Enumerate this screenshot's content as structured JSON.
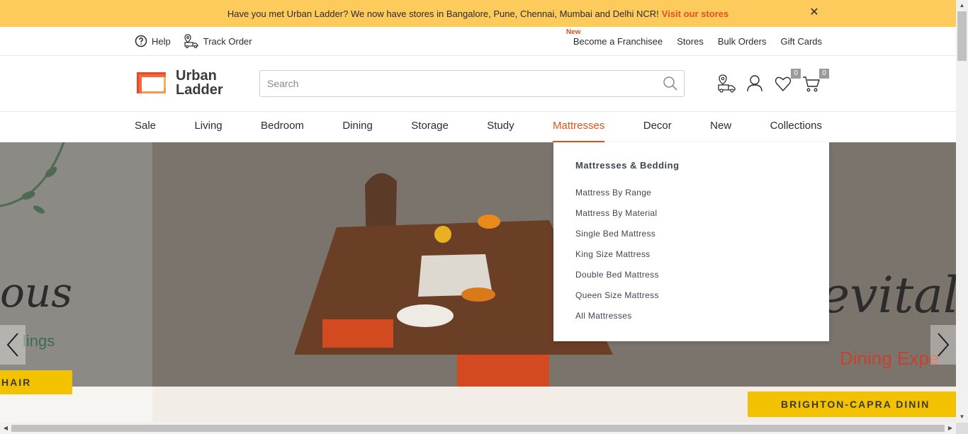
{
  "announcement": {
    "text": "Have you met Urban Ladder? We now have stores in Bangalore, Pune, Chennai, Mumbai and Delhi NCR!",
    "link": "Visit our stores",
    "close": "✕"
  },
  "utility": {
    "help": "Help",
    "track_order": "Track Order",
    "new_tag": "New",
    "right_links": [
      "Become a Franchisee",
      "Stores",
      "Bulk Orders",
      "Gift Cards"
    ]
  },
  "header": {
    "logo_line1": "Urban",
    "logo_line2": "Ladder",
    "search_placeholder": "Search",
    "wishlist_count": "0",
    "cart_count": "0"
  },
  "nav": {
    "items": [
      "Sale",
      "Living",
      "Bedroom",
      "Dining",
      "Storage",
      "Study",
      "Mattresses",
      "Decor",
      "New",
      "Collections"
    ],
    "active": "Mattresses"
  },
  "dropdown": {
    "heading": "Mattresses & Bedding",
    "links": [
      "Mattress By Range",
      "Mattress By Material",
      "Single Bed Mattress",
      "King Size Mattress",
      "Double Bed Mattress",
      "Queen Size Mattress",
      "All Mattresses"
    ]
  },
  "hero": {
    "left_script": "ous",
    "left_sub": "lings",
    "left_ribbon": "HAIR",
    "right_script": "Revitalise",
    "right_sub": "Dining Expe",
    "right_ribbon": "BRIGHTON-CAPRA DININ"
  },
  "colors": {
    "accent": "#e1521f",
    "announce_bg": "#fdca5c",
    "ribbon": "#f2c200"
  }
}
